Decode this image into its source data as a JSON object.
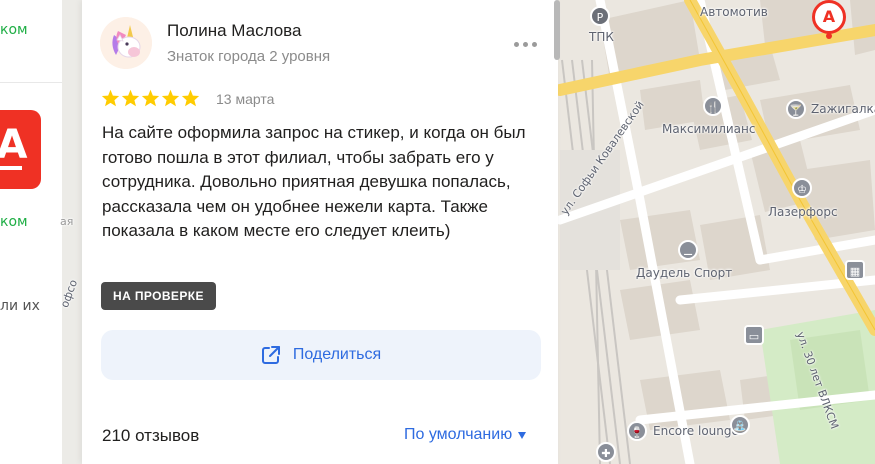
{
  "left_panel": {
    "green_texts": [
      "ком",
      "ком"
    ],
    "partial_text": "ли их"
  },
  "review": {
    "author": "Полина Маслова",
    "author_level": "Знаток города 2 уровня",
    "rating": 5,
    "date": "13 марта",
    "text": "На сайте оформила запрос на стикер, и когда он был готово пошла в этот филиал, чтобы забрать его у сотрудника. Довольно приятная девушка попалась, рассказала чем он удобнее нежели карта. Также показала в каком месте его следует клеить)",
    "status": "НА ПРОВЕРКЕ",
    "share_label": "Поделиться"
  },
  "footer": {
    "reviews_count": "210 отзывов",
    "sort_label": "По умолчанию"
  },
  "map": {
    "labels": {
      "tpk": "ТПК",
      "avtomotiv": "Автомотив",
      "zazhigalka": "Zажигалка",
      "maksimilians": "Максимилианс",
      "lazerfors": "Лазерфорс",
      "daudel": "Даудель Спорт",
      "encore": "Encore lounge",
      "street_kovalevskoy": "ул. Софьи Ковалевской",
      "street_30let": "ул. 30 лет ВЛКСМ",
      "street_left": "офсо",
      "street_left_top": "ая"
    },
    "marker_letter": "А"
  },
  "colors": {
    "accent_blue": "#2e6be0",
    "star_yellow": "#fc0",
    "alfa_red": "#ef3124",
    "green": "#1fae45",
    "badge_bg": "#4a4a4a"
  }
}
